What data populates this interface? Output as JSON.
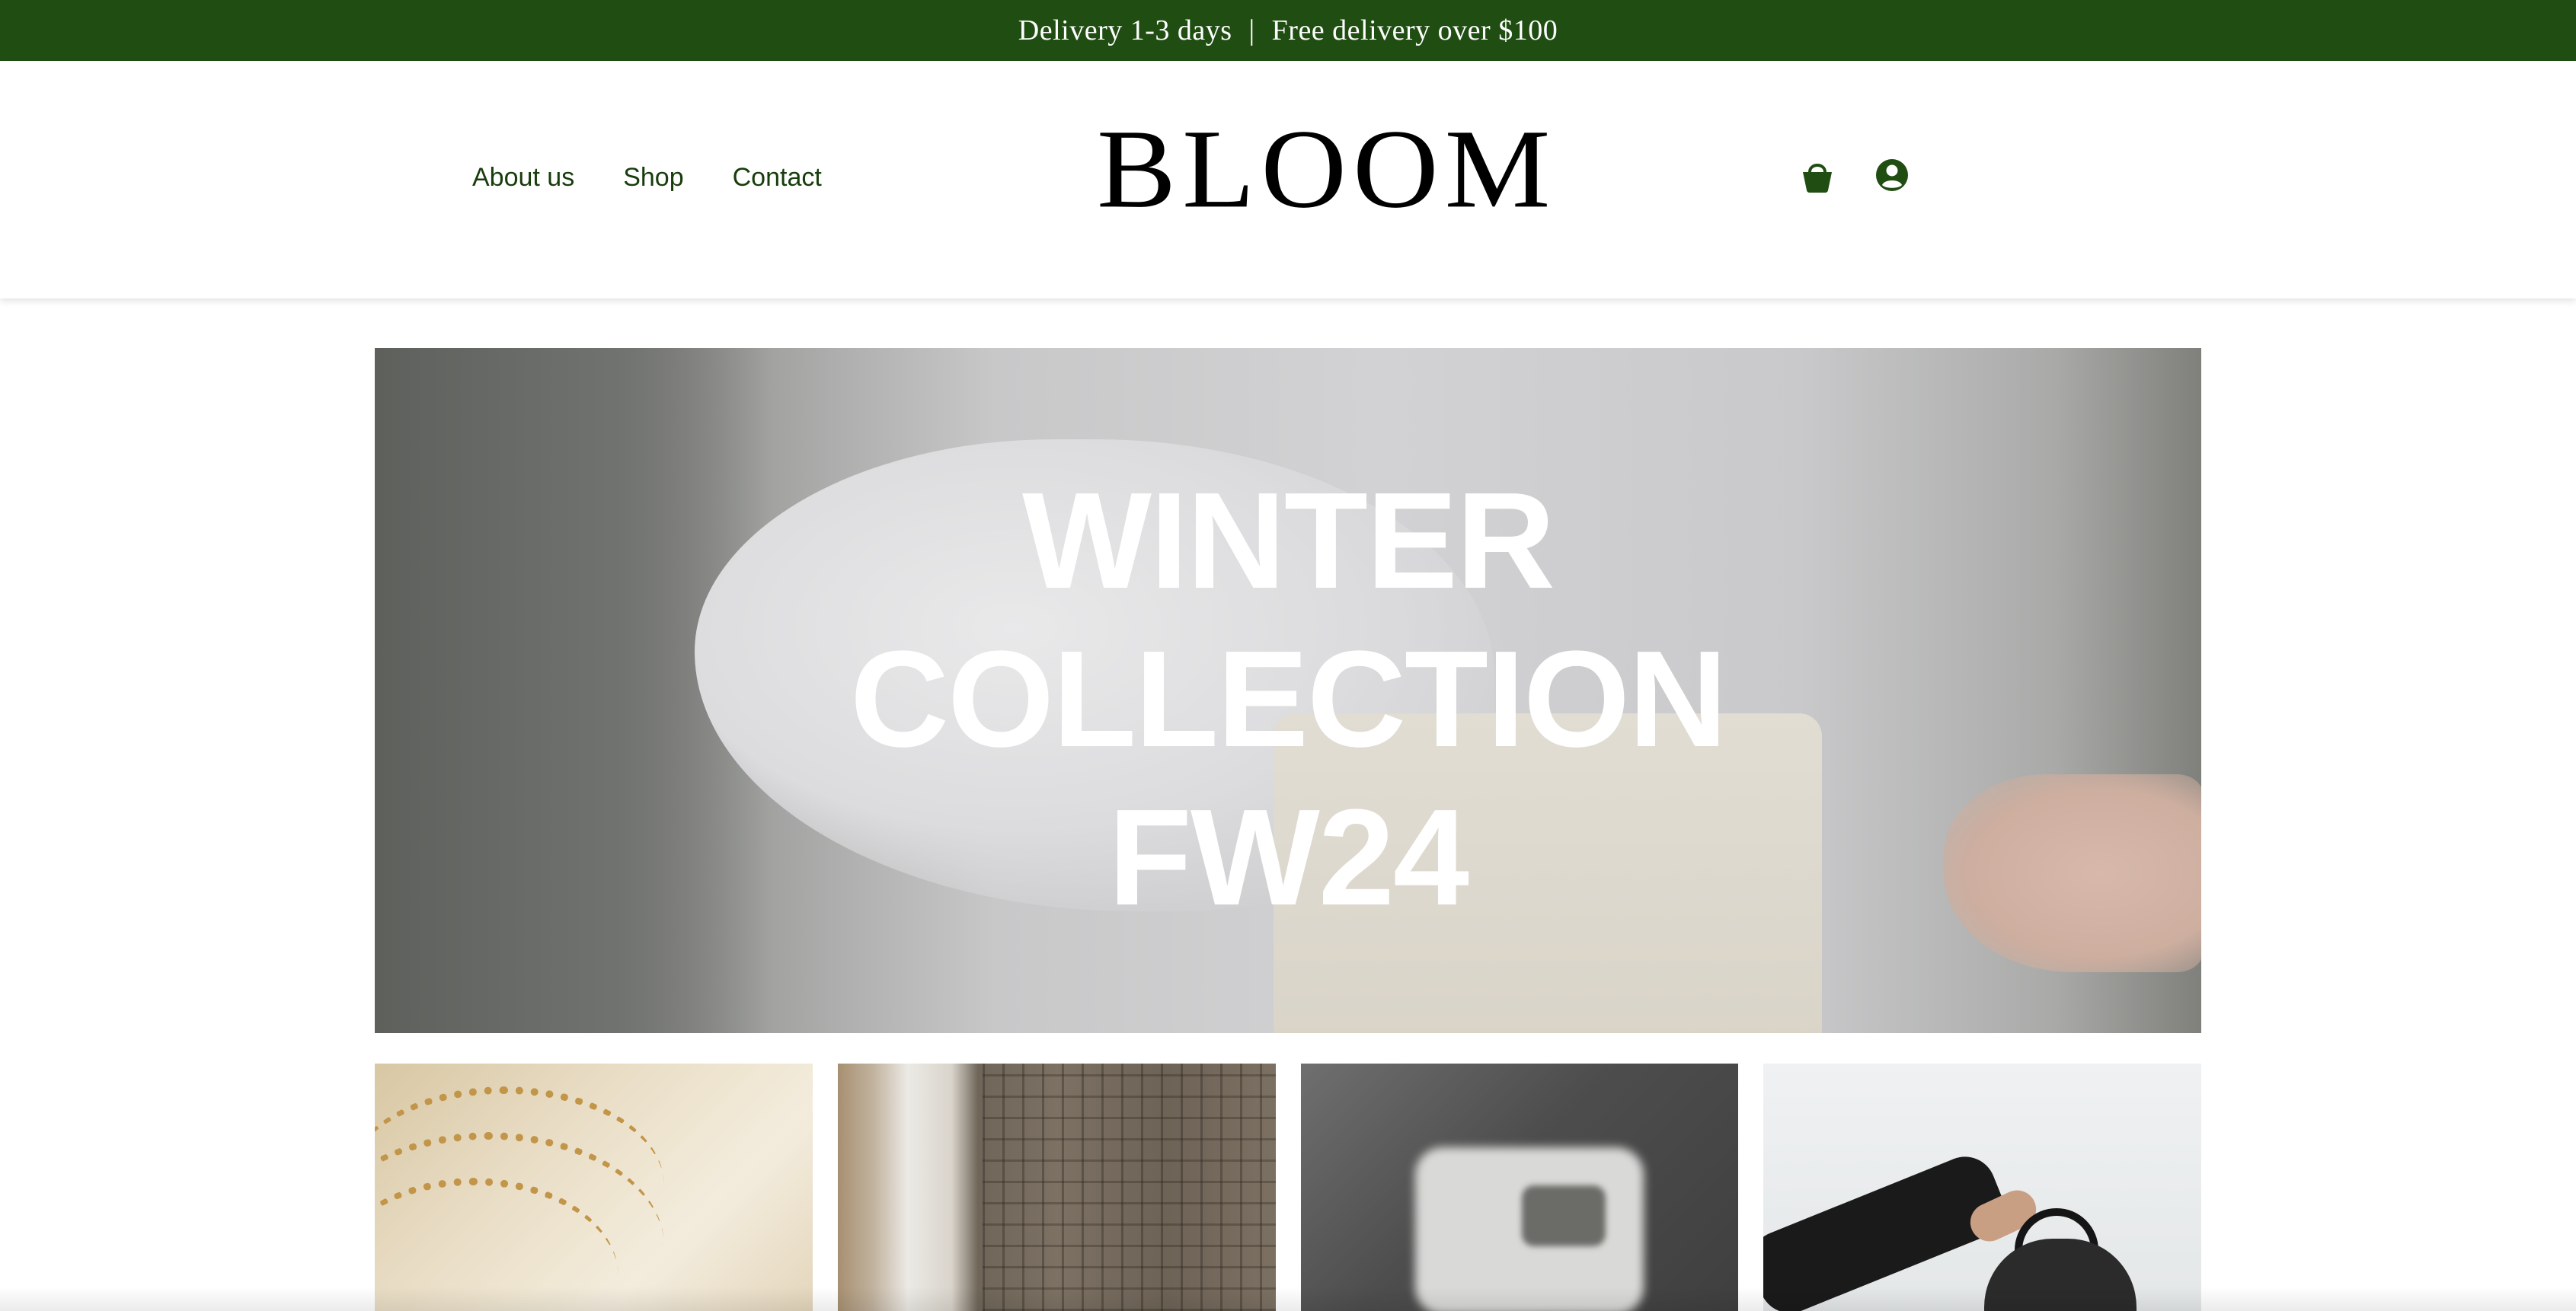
{
  "announcement": {
    "delivery": "Delivery 1-3 days",
    "separator": "|",
    "free_delivery": "Free delivery over $100"
  },
  "header": {
    "nav": [
      {
        "label": "About us"
      },
      {
        "label": "Shop"
      },
      {
        "label": "Contact"
      }
    ],
    "logo": "BLOOM",
    "icons": [
      "basket-icon",
      "account-icon"
    ]
  },
  "hero": {
    "lines": [
      "WINTER",
      "COLLECTION",
      "FW24"
    ]
  },
  "tiles": [
    {
      "name": "gold-chains-tile"
    },
    {
      "name": "plaid-fabric-tile"
    },
    {
      "name": "camera-box-tile"
    },
    {
      "name": "backpack-tile"
    }
  ],
  "colors": {
    "brand_green": "#1f4d12",
    "nav_text": "#173d0c",
    "logo_text": "#000000",
    "hero_text": "#ffffff"
  }
}
